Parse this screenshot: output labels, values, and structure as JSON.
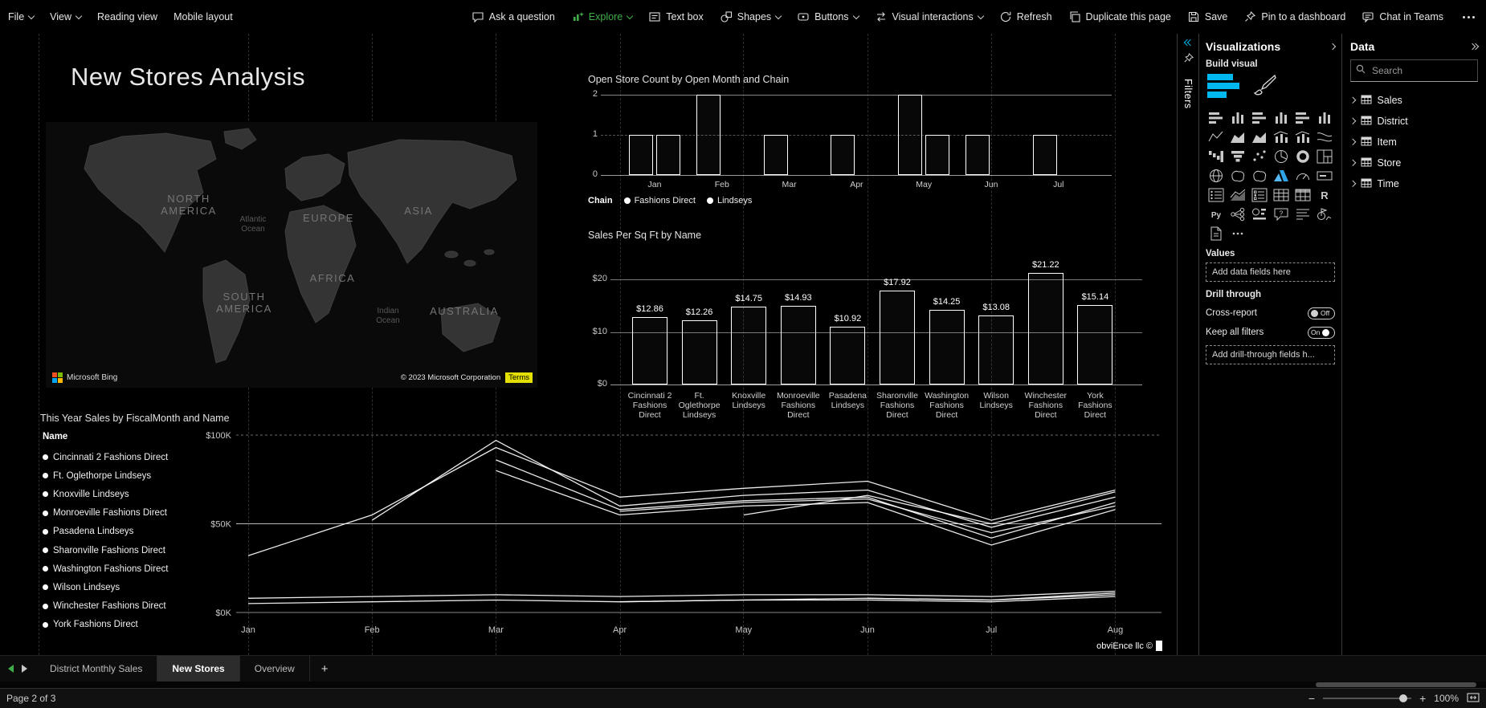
{
  "colors": {
    "accent_cyan": "#00b8f0",
    "explore_green": "#3fae49",
    "terms_yellow": "#e3e000",
    "ms_logo": [
      "#f25022",
      "#7fba00",
      "#00a4ef",
      "#ffb900"
    ]
  },
  "menubar": {
    "left": [
      {
        "label": "File",
        "caret": true
      },
      {
        "label": "View",
        "caret": true
      },
      {
        "label": "Reading view",
        "caret": false
      },
      {
        "label": "Mobile layout",
        "caret": false
      }
    ],
    "right": [
      {
        "label": "Ask a question",
        "icon": "speech-bubble-icon",
        "caret": false,
        "accent": false
      },
      {
        "label": "Explore",
        "icon": "explore-icon",
        "caret": true,
        "accent": true
      },
      {
        "label": "Text box",
        "icon": "text-box-icon",
        "caret": false,
        "accent": false
      },
      {
        "label": "Shapes",
        "icon": "shapes-icon",
        "caret": true,
        "accent": false
      },
      {
        "label": "Buttons",
        "icon": "buttons-icon",
        "caret": true,
        "accent": false
      },
      {
        "label": "Visual interactions",
        "icon": "visual-interactions-icon",
        "caret": true,
        "accent": false
      },
      {
        "label": "Refresh",
        "icon": "refresh-icon",
        "caret": false,
        "accent": false
      },
      {
        "label": "Duplicate this page",
        "icon": "duplicate-icon",
        "caret": false,
        "accent": false
      },
      {
        "label": "Save",
        "icon": "save-icon",
        "caret": false,
        "accent": false
      },
      {
        "label": "Pin to a dashboard",
        "icon": "pin-icon",
        "caret": false,
        "accent": false
      },
      {
        "label": "Chat in Teams",
        "icon": "chat-icon",
        "caret": false,
        "accent": false
      }
    ]
  },
  "canvas": {
    "title": "New Stores Analysis",
    "watermark": "obviEnce llc ©",
    "map": {
      "region_labels": [
        "NORTH AMERICA",
        "EUROPE",
        "ASIA",
        "AFRICA",
        "SOUTH AMERICA",
        "AUSTRALIA"
      ],
      "ocean_labels": [
        "Atlantic Ocean",
        "Indian Ocean"
      ],
      "bing_label": "Microsoft Bing",
      "copyright": "© 2023 Microsoft Corporation",
      "terms_label": "Terms"
    }
  },
  "chart_data": [
    {
      "type": "bar",
      "title": "Open Store Count by Open Month and Chain",
      "categories": [
        "Jan",
        "Feb",
        "Mar",
        "Apr",
        "May",
        "Jun",
        "Jul"
      ],
      "series": [
        {
          "name": "Fashions Direct",
          "values": [
            1,
            2,
            1,
            1,
            2,
            1,
            1
          ]
        },
        {
          "name": "Lindseys",
          "values": [
            1,
            0,
            0,
            0,
            1,
            0,
            0
          ]
        }
      ],
      "legend_title": "Chain",
      "legend_position": "bottom",
      "xlabel": "",
      "ylabel": "",
      "ylim": [
        0,
        2
      ],
      "yticks_labels": [
        "0",
        "1",
        "2"
      ],
      "grid": true
    },
    {
      "type": "bar",
      "title": "Sales Per Sq Ft by Name",
      "categories": [
        "Cincinnati 2 Fashions Direct",
        "Ft. Oglethorpe Lindseys",
        "Knoxville Lindseys",
        "Monroeville Fashions Direct",
        "Pasadena Lindseys",
        "Sharonville Fashions Direct",
        "Washington Fashions Direct",
        "Wilson Lindseys",
        "Winchester Fashions Direct",
        "York Fashions Direct"
      ],
      "values": [
        12.86,
        12.26,
        14.75,
        14.93,
        10.92,
        17.92,
        14.25,
        13.08,
        21.22,
        15.14
      ],
      "data_labels": [
        "$12.86",
        "$12.26",
        "$14.75",
        "$14.93",
        "$10.92",
        "$17.92",
        "$14.25",
        "$13.08",
        "$21.22",
        "$15.14"
      ],
      "xlabel": "",
      "ylabel": "",
      "ylim": [
        0,
        24
      ],
      "yticks_labels": [
        "$0",
        "$10",
        "$20"
      ],
      "grid": true
    },
    {
      "type": "line",
      "title": "This Year Sales by FiscalMonth and Name",
      "x": [
        "Jan",
        "Feb",
        "Mar",
        "Apr",
        "May",
        "Jun",
        "Jul",
        "Aug"
      ],
      "legend_title": "Name",
      "legend_position": "left",
      "ylim": [
        0,
        100
      ],
      "yticks_labels": [
        "$0K",
        "$50K",
        "$100K"
      ],
      "grid": true,
      "units": "K$",
      "series": [
        {
          "name": "Cincinnati 2 Fashions Direct",
          "values": [
            8,
            9,
            10,
            9,
            10,
            10,
            9,
            12
          ]
        },
        {
          "name": "Ft. Oglethorpe Lindseys",
          "values": [
            5,
            6,
            7,
            6,
            7,
            7,
            6,
            9
          ]
        },
        {
          "name": "Knoxville Lindseys",
          "values": [
            null,
            null,
            null,
            6,
            7,
            8,
            7,
            10
          ]
        },
        {
          "name": "Monroeville Fashions Direct",
          "values": [
            32,
            55,
            93,
            65,
            70,
            74,
            52,
            69
          ]
        },
        {
          "name": "Pasadena Lindseys",
          "values": [
            null,
            52,
            97,
            60,
            66,
            69,
            48,
            65
          ]
        },
        {
          "name": "Sharonville Fashions Direct",
          "values": [
            null,
            null,
            86,
            58,
            63,
            65,
            42,
            62
          ]
        },
        {
          "name": "Washington Fashions Direct",
          "values": [
            null,
            null,
            80,
            55,
            60,
            62,
            38,
            58
          ]
        },
        {
          "name": "Wilson Lindseys",
          "values": [
            null,
            null,
            null,
            57,
            62,
            64,
            45,
            60
          ]
        },
        {
          "name": "Winchester Fashions Direct",
          "values": [
            null,
            null,
            null,
            null,
            55,
            66,
            50,
            68
          ]
        },
        {
          "name": "York Fashions Direct",
          "values": [
            null,
            null,
            null,
            null,
            null,
            8,
            7,
            11
          ]
        }
      ]
    }
  ],
  "filters_pane": {
    "label": "Filters"
  },
  "visualizations_pane": {
    "title": "Visualizations",
    "build_visual_label": "Build visual",
    "values_label": "Values",
    "add_fields_placeholder": "Add data fields here",
    "drill_through_label": "Drill through",
    "cross_report": {
      "label": "Cross-report",
      "state": "Off"
    },
    "keep_all_filters": {
      "label": "Keep all filters",
      "state": "On"
    },
    "add_drill_placeholder": "Add drill-through fields h...",
    "visual_types": [
      {
        "name": "stacked-bar-chart-icon",
        "kind": "barsH"
      },
      {
        "name": "stacked-column-chart-icon",
        "kind": "barsV"
      },
      {
        "name": "clustered-bar-chart-icon",
        "kind": "barsH"
      },
      {
        "name": "clustered-column-chart-icon",
        "kind": "barsV"
      },
      {
        "name": "100-stacked-bar-chart-icon",
        "kind": "barsH"
      },
      {
        "name": "100-stacked-column-chart-icon",
        "kind": "barsV"
      },
      {
        "name": "line-chart-icon",
        "kind": "line"
      },
      {
        "name": "area-chart-icon",
        "kind": "area"
      },
      {
        "name": "stacked-area-chart-icon",
        "kind": "area"
      },
      {
        "name": "line-and-stacked-column-chart-icon",
        "kind": "combo"
      },
      {
        "name": "line-and-clustered-column-chart-icon",
        "kind": "combo"
      },
      {
        "name": "ribbon-chart-icon",
        "kind": "ribbon"
      },
      {
        "name": "waterfall-chart-icon",
        "kind": "waterfall"
      },
      {
        "name": "funnel-chart-icon",
        "kind": "funnel"
      },
      {
        "name": "scatter-chart-icon",
        "kind": "scatter"
      },
      {
        "name": "pie-chart-icon",
        "kind": "pie"
      },
      {
        "name": "donut-chart-icon",
        "kind": "donut"
      },
      {
        "name": "treemap-icon",
        "kind": "treemap"
      },
      {
        "name": "map-icon",
        "kind": "map"
      },
      {
        "name": "filled-map-icon",
        "kind": "blob"
      },
      {
        "name": "shape-map-icon",
        "kind": "blob"
      },
      {
        "name": "azure-map-icon",
        "kind": "azure"
      },
      {
        "name": "gauge-icon",
        "kind": "gauge"
      },
      {
        "name": "card-icon",
        "kind": "card"
      },
      {
        "name": "multi-row-card-icon",
        "kind": "mcard"
      },
      {
        "name": "kpi-icon",
        "kind": "kpi"
      },
      {
        "name": "slicer-icon",
        "kind": "slicer"
      },
      {
        "name": "table-icon",
        "kind": "table"
      },
      {
        "name": "matrix-icon",
        "kind": "matrix"
      },
      {
        "name": "r-script-visual-icon",
        "kind": "R"
      },
      {
        "name": "python-visual-icon",
        "kind": "Py"
      },
      {
        "name": "decomposition-tree-icon",
        "kind": "tree"
      },
      {
        "name": "key-influencers-icon",
        "kind": "influencers"
      },
      {
        "name": "qa-visual-icon",
        "kind": "qa"
      },
      {
        "name": "smart-narrative-icon",
        "kind": "narrative"
      },
      {
        "name": "metrics-icon",
        "kind": "metrics"
      },
      {
        "name": "paginated-report-icon",
        "kind": "doc"
      },
      {
        "name": "get-more-visuals-icon",
        "kind": "ellipsis"
      }
    ]
  },
  "data_pane": {
    "title": "Data",
    "search_placeholder": "Search",
    "tables": [
      "Sales",
      "District",
      "Item",
      "Store",
      "Time"
    ]
  },
  "page_tabs": {
    "tabs": [
      "District Monthly Sales",
      "New Stores",
      "Overview"
    ],
    "active_index": 1,
    "add_page_label": "+"
  },
  "statusbar": {
    "page_label": "Page 2 of 3",
    "zoom_out_icon": "−",
    "zoom_in_icon": "+",
    "zoom_level": "100%"
  }
}
